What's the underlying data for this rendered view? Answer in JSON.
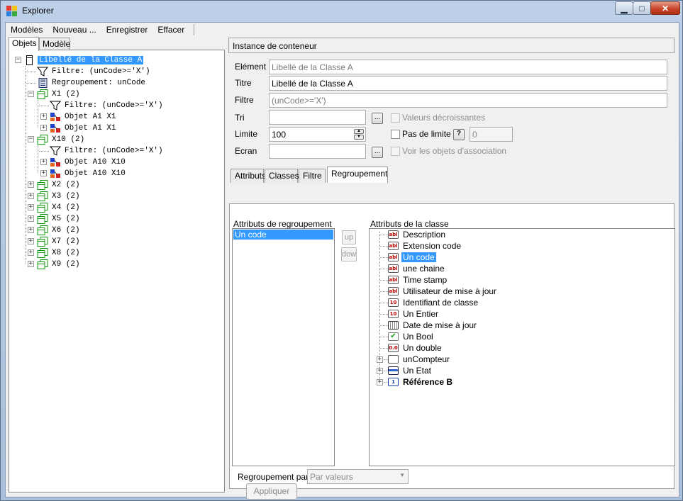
{
  "window": {
    "title": "Explorer",
    "controls": {
      "minimize": "▁",
      "maximize": "□",
      "close": "✕"
    }
  },
  "menu": [
    "Modèles",
    "Nouveau ...",
    "Enregistrer",
    "Effacer"
  ],
  "left_tabs": [
    "Objets",
    "Modèle"
  ],
  "tree": [
    {
      "label": "Libellé de la Classe A",
      "icon": "class-object-icon",
      "level": 0,
      "expander": "minus",
      "selected": true
    },
    {
      "label": "Filtre: (unCode>='X')",
      "icon": "filter-funnel-icon",
      "level": 1,
      "expander": null
    },
    {
      "label": "Regroupement: unCode",
      "icon": "grouping-icon",
      "level": 1,
      "expander": null
    },
    {
      "label": "X1 (2)",
      "icon": "group-folder-icon",
      "level": 1,
      "expander": "minus"
    },
    {
      "label": "Filtre: (unCode>='X')",
      "icon": "filter-funnel-icon",
      "level": 2,
      "expander": null
    },
    {
      "label": "Objet A1 X1",
      "icon": "object-cubes-icon",
      "level": 2,
      "expander": "plus"
    },
    {
      "label": "Objet A1 X1",
      "icon": "object-cubes-icon",
      "level": 2,
      "expander": "plus"
    },
    {
      "label": "X10 (2)",
      "icon": "group-folder-icon",
      "level": 1,
      "expander": "minus"
    },
    {
      "label": "Filtre: (unCode>='X')",
      "icon": "filter-funnel-icon",
      "level": 2,
      "expander": null
    },
    {
      "label": "Objet A10 X10",
      "icon": "object-cubes-icon",
      "level": 2,
      "expander": "plus"
    },
    {
      "label": "Objet A10 X10",
      "icon": "object-cubes-icon",
      "level": 2,
      "expander": "plus"
    },
    {
      "label": "X2 (2)",
      "icon": "group-folder-icon",
      "level": 1,
      "expander": "plus"
    },
    {
      "label": "X3 (2)",
      "icon": "group-folder-icon",
      "level": 1,
      "expander": "plus"
    },
    {
      "label": "X4 (2)",
      "icon": "group-folder-icon",
      "level": 1,
      "expander": "plus"
    },
    {
      "label": "X5 (2)",
      "icon": "group-folder-icon",
      "level": 1,
      "expander": "plus"
    },
    {
      "label": "X6 (2)",
      "icon": "group-folder-icon",
      "level": 1,
      "expander": "plus"
    },
    {
      "label": "X7 (2)",
      "icon": "group-folder-icon",
      "level": 1,
      "expander": "plus"
    },
    {
      "label": "X8 (2)",
      "icon": "group-folder-icon",
      "level": 1,
      "expander": "plus"
    },
    {
      "label": "X9 (2)",
      "icon": "group-folder-icon",
      "level": 1,
      "expander": "plus"
    }
  ],
  "instance": {
    "header": "Instance de conteneur",
    "element_label": "Elément",
    "element_value": "Libellé de la Classe A",
    "titre_label": "Titre",
    "titre_value": "Libellé de la Classe A",
    "filtre_label": "Filtre",
    "filtre_value": "(unCode>='X')",
    "tri_label": "Tri",
    "tri_value": "",
    "limite_label": "Limite",
    "limite_value": "100",
    "ecran_label": "Ecran",
    "ecran_value": "",
    "browse": "...",
    "valeurs_decroissantes": "Valeurs décroissantes",
    "pas_de_limite": "Pas de limite",
    "help": "?",
    "limit_spin_value": "0",
    "voir_objets": "Voir les objets d'association"
  },
  "tabs": [
    "Attributs",
    "Classes",
    "Filtre",
    "Regroupement"
  ],
  "regroupement": {
    "left_title": "Attributs de regroupement",
    "left_items": [
      "Un code"
    ],
    "up": "up",
    "down": "down",
    "right_title": "Attributs de la classe",
    "attributes": [
      {
        "label": "Description",
        "icon": "text-abl-icon",
        "icon_text": "abl"
      },
      {
        "label": "Extension code",
        "icon": "text-abl-icon",
        "icon_text": "abl"
      },
      {
        "label": "Un code",
        "icon": "text-abl-icon",
        "icon_text": "abl",
        "selected": true
      },
      {
        "label": "une chaine",
        "icon": "text-abl-icon",
        "icon_text": "abl"
      },
      {
        "label": "Time stamp",
        "icon": "text-abl-icon",
        "icon_text": "abl"
      },
      {
        "label": "Utilisateur de mise à jour",
        "icon": "text-abl-icon",
        "icon_text": "abl"
      },
      {
        "label": "Identifiant de classe",
        "icon": "integer-icon",
        "icon_text": "10"
      },
      {
        "label": "Un Entier",
        "icon": "integer-icon",
        "icon_text": "10"
      },
      {
        "label": "Date de mise à jour",
        "icon": "calendar-icon",
        "icon_text": ""
      },
      {
        "label": "Un Bool",
        "icon": "checkmark-icon",
        "icon_text": "✔"
      },
      {
        "label": "Un double",
        "icon": "double-icon",
        "icon_text": "0.0"
      },
      {
        "label": "unCompteur",
        "icon": "counter-icon",
        "icon_text": "",
        "expander": "plus"
      },
      {
        "label": "Un Etat",
        "icon": "state-list-icon",
        "icon_text": "",
        "expander": "plus"
      },
      {
        "label": "Référence B",
        "icon": "reference-icon",
        "icon_text": "1",
        "expander": "plus",
        "bold": true
      }
    ],
    "group_by_label": "Regroupement par",
    "group_by_value": "Par valeurs"
  },
  "apply_label": "Appliquer"
}
